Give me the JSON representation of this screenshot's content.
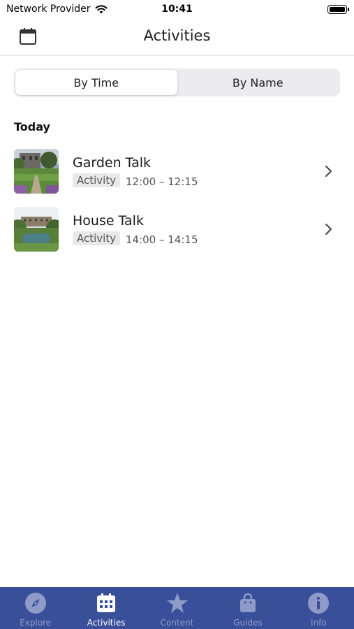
{
  "status_bar": {
    "carrier": "Network Provider",
    "time": "10:41"
  },
  "nav": {
    "title": "Activities",
    "left_icon": "calendar-icon"
  },
  "segmented": {
    "options": [
      "By Time",
      "By Name"
    ],
    "selected": "By Time"
  },
  "section": {
    "title": "Today"
  },
  "activities": [
    {
      "title": "Garden Talk",
      "badge": "Activity",
      "time": "12:00 – 12:15",
      "thumb": "garden-thumbnail"
    },
    {
      "title": "House Talk",
      "badge": "Activity",
      "time": "14:00 – 14:15",
      "thumb": "house-thumbnail"
    }
  ],
  "tab_bar": {
    "items": [
      {
        "label": "Explore",
        "icon": "compass-icon"
      },
      {
        "label": "Activities",
        "icon": "calendar-grid-icon"
      },
      {
        "label": "Content",
        "icon": "star-icon"
      },
      {
        "label": "Guides",
        "icon": "bag-icon"
      },
      {
        "label": "Info",
        "icon": "info-icon"
      }
    ],
    "selected": "Activities"
  },
  "colors": {
    "tab_bar_bg": "#3a4f99",
    "tab_inactive": "#8e9bc8",
    "tab_active": "#ffffff"
  }
}
